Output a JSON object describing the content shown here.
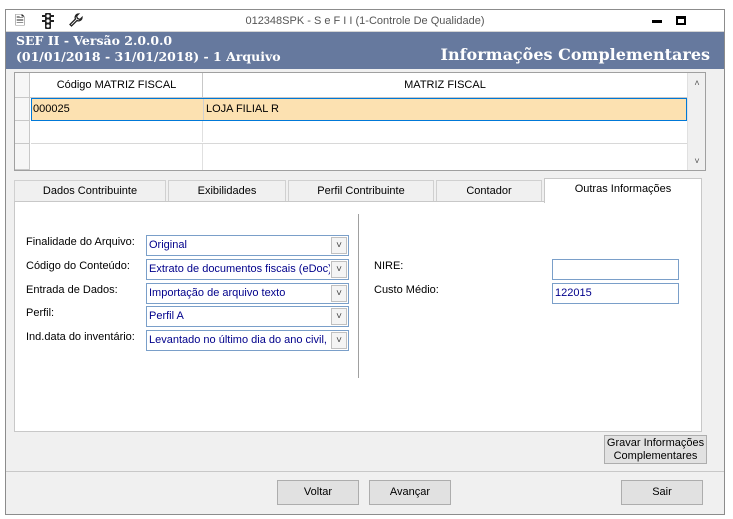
{
  "window": {
    "title": "012348SPK - S e F  I I (1-Controle De Qualidade)",
    "icons": [
      "document-icon",
      "traffic-light-icon",
      "wrench-icon"
    ]
  },
  "banner": {
    "system": "SEF II - Versão 2.0.0.0",
    "period": "(01/01/2018 - 31/01/2018) - 1 Arquivo",
    "section": "Informações Complementares",
    "color": "#66799e"
  },
  "grid": {
    "columns": [
      "Código MATRIZ FISCAL",
      "MATRIZ FISCAL"
    ],
    "rows": [
      {
        "code": "000025",
        "name": "LOJA FILIAL R",
        "selected": true
      },
      {
        "code": "",
        "name": "",
        "selected": false
      },
      {
        "code": "",
        "name": "",
        "selected": false
      }
    ],
    "selected_row_color": "#fce1b1"
  },
  "tabs": [
    "Dados Contribuinte",
    "Exibilidades",
    "Perfil Contribuinte",
    "Contador",
    "Outras Informações"
  ],
  "active_tab": "Outras Informações",
  "form": {
    "finalidade": {
      "label": "Finalidade do Arquivo:",
      "value": "Original"
    },
    "codigo_conteudo": {
      "label": "Código do Conteúdo:",
      "value": "Extrato de documentos fiscais (eDoc)"
    },
    "entrada": {
      "label": "Entrada de Dados:",
      "value": "Importação de arquivo texto"
    },
    "perfil": {
      "label": "Perfil:",
      "value": "Perfil A"
    },
    "ind_data": {
      "label": "Ind.data do inventário:",
      "value": "Levantado no último dia do ano civil, c"
    },
    "nire": {
      "label": "NIRE:",
      "value": ""
    },
    "custo_medio": {
      "label": "Custo Médio:",
      "value": "122015"
    }
  },
  "buttons": {
    "gravar_line1": "Gravar Informações",
    "gravar_line2": "Complementares",
    "voltar": "Voltar",
    "avancar": "Avançar",
    "sair": "Sair"
  }
}
